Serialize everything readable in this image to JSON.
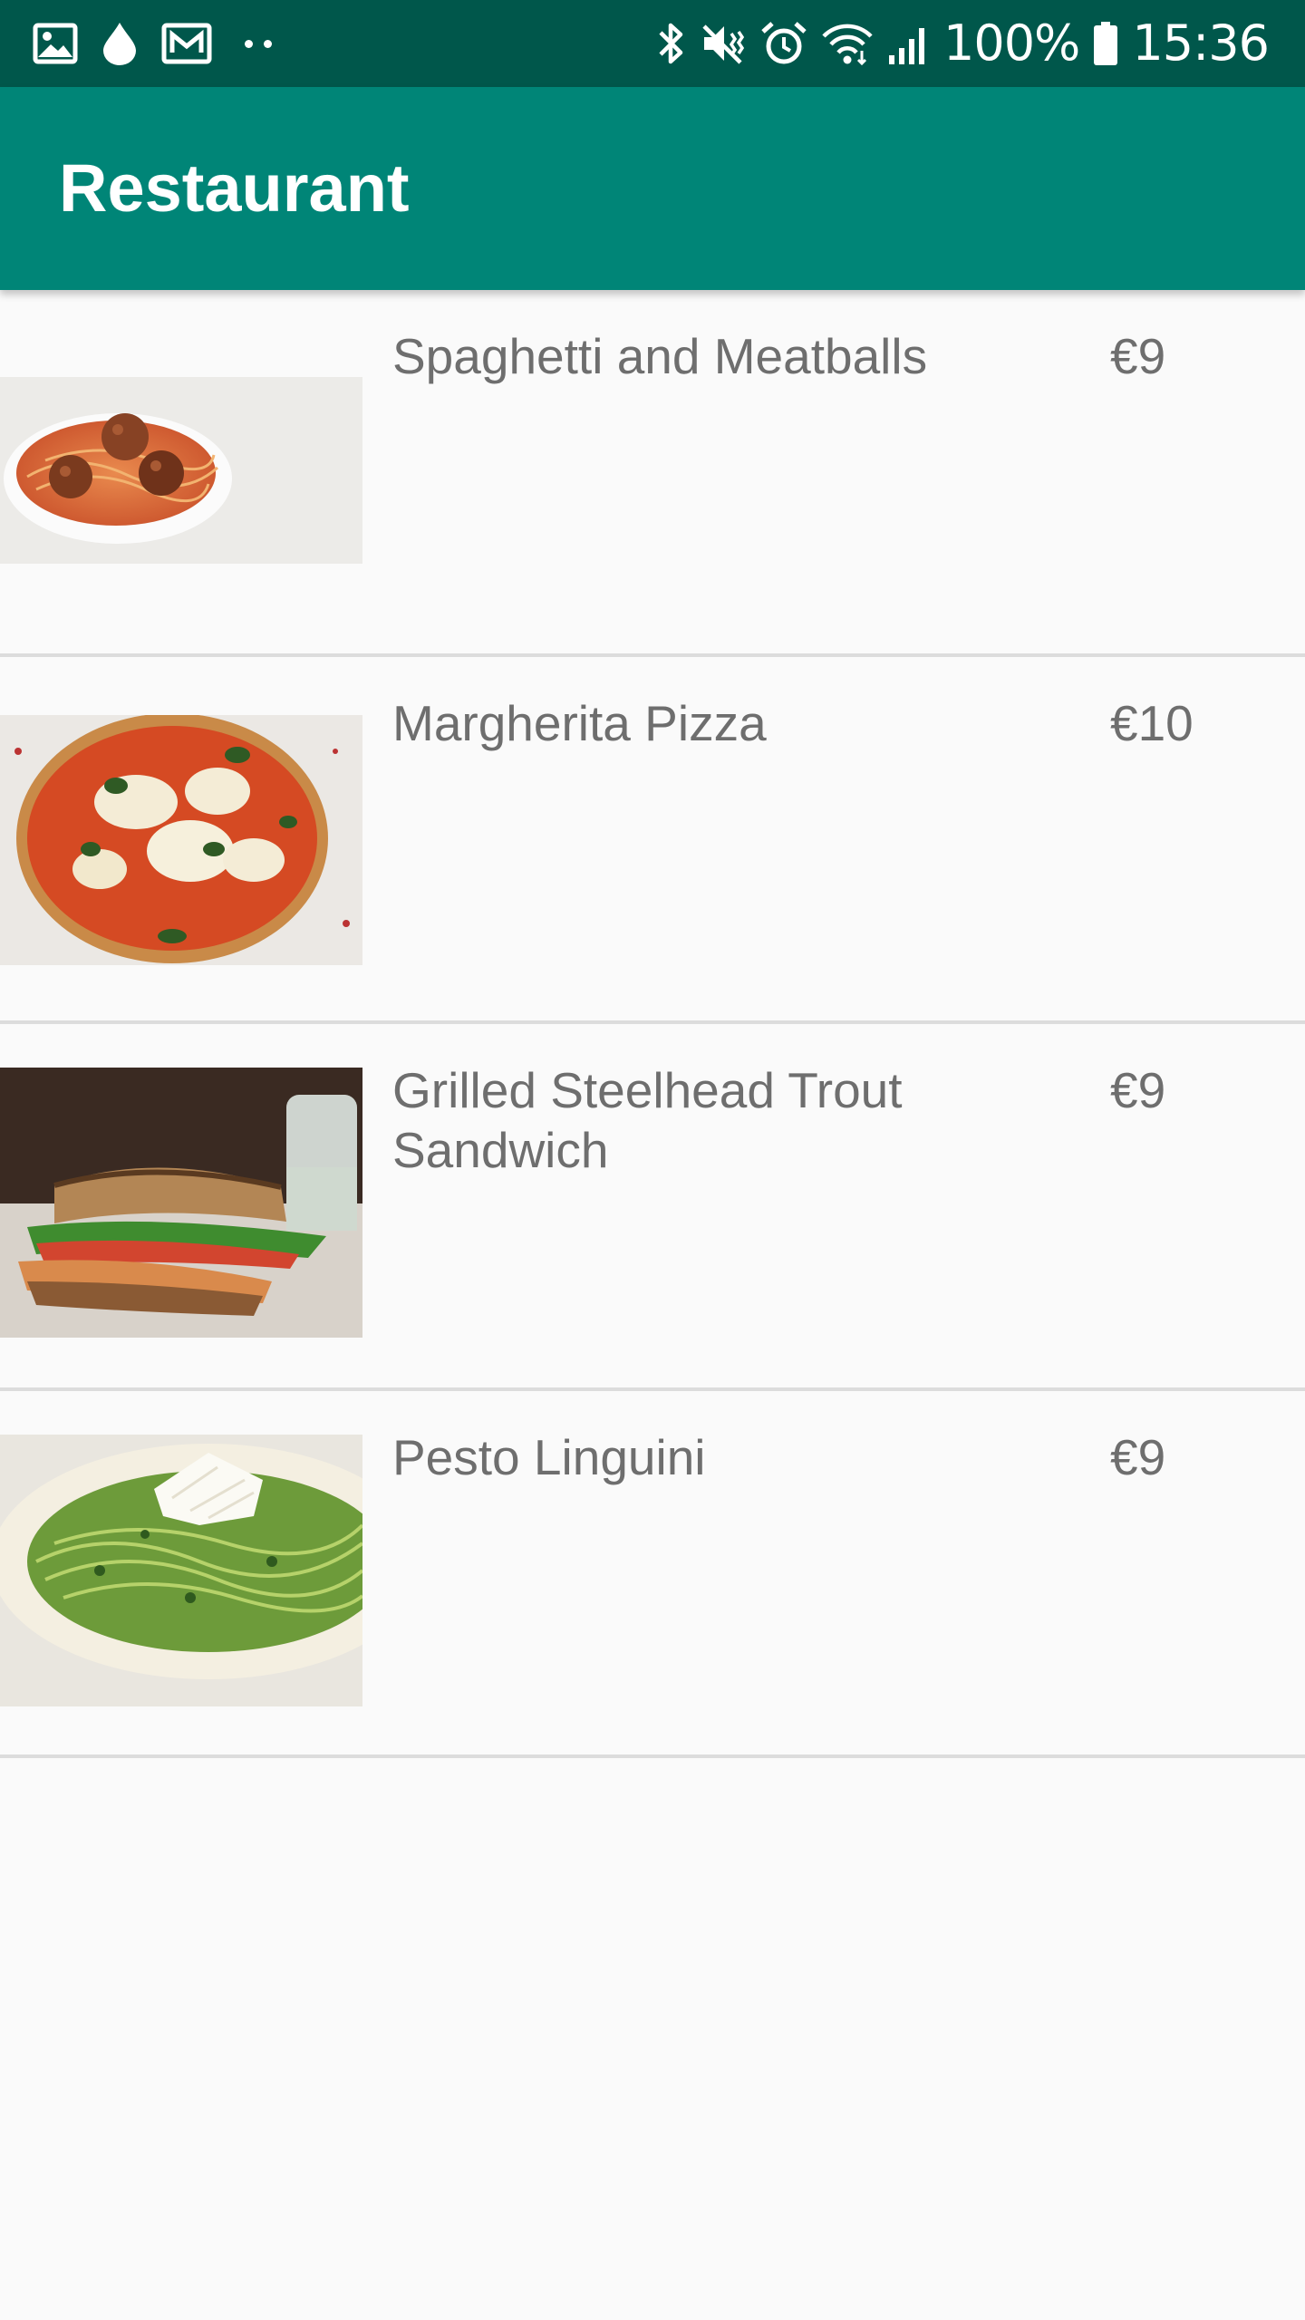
{
  "status_bar": {
    "left_icons": [
      "gallery-icon",
      "droplet-icon",
      "email-icon",
      "more-dots-icon"
    ],
    "right_icons": [
      "bluetooth-icon",
      "vibrate-off-icon",
      "alarm-icon",
      "wifi-icon",
      "signal-icon",
      "battery-icon"
    ],
    "battery": "100%",
    "time": "15:36"
  },
  "app_bar": {
    "title": "Restaurant",
    "color": "#008577",
    "status_color": "#00574b"
  },
  "menu": {
    "items": [
      {
        "name": "Spaghetti and Meatballs",
        "price": "€9",
        "image": "spaghetti-meatballs-photo"
      },
      {
        "name": "Margherita Pizza",
        "price": "€10",
        "image": "margherita-pizza-photo"
      },
      {
        "name": "Grilled Steelhead Trout Sandwich",
        "price": "€9",
        "image": "trout-sandwich-photo"
      },
      {
        "name": "Pesto Linguini",
        "price": "€9",
        "image": "pesto-linguini-photo"
      }
    ]
  }
}
